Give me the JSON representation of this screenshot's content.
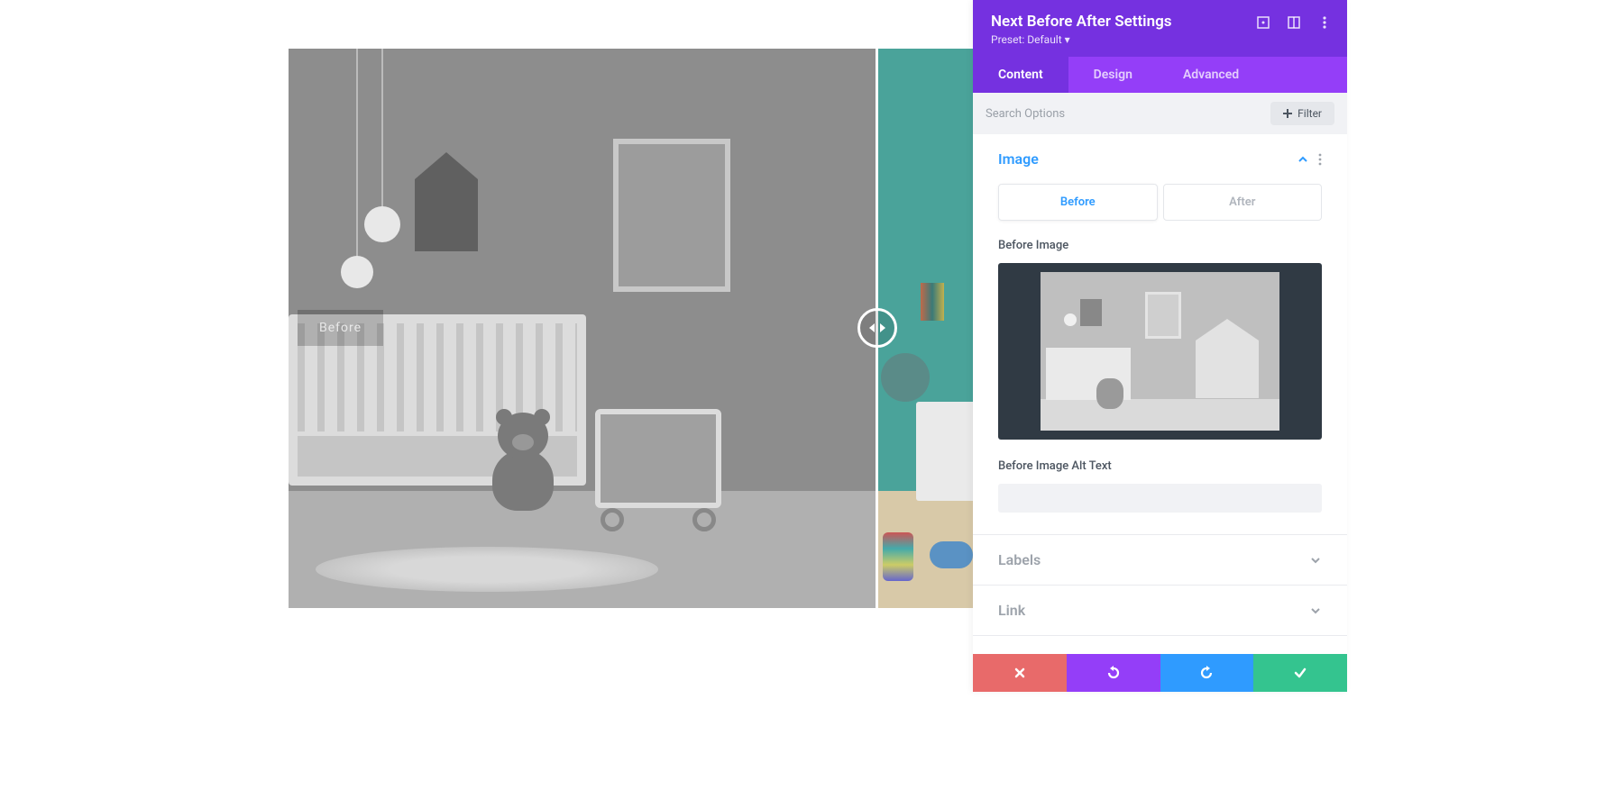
{
  "panel": {
    "title": "Next Before After Settings",
    "preset_label": "Preset: Default"
  },
  "tabs": {
    "content": "Content",
    "design": "Design",
    "advanced": "Advanced"
  },
  "search": {
    "placeholder": "Search Options",
    "filter_label": "Filter"
  },
  "sections": {
    "image": {
      "title": "Image",
      "tab_before": "Before",
      "tab_after": "After",
      "before_image_label": "Before Image",
      "before_alt_label": "Before Image Alt Text",
      "before_alt_value": ""
    },
    "labels": {
      "title": "Labels"
    },
    "link": {
      "title": "Link"
    }
  },
  "preview": {
    "before_label": "Before"
  }
}
